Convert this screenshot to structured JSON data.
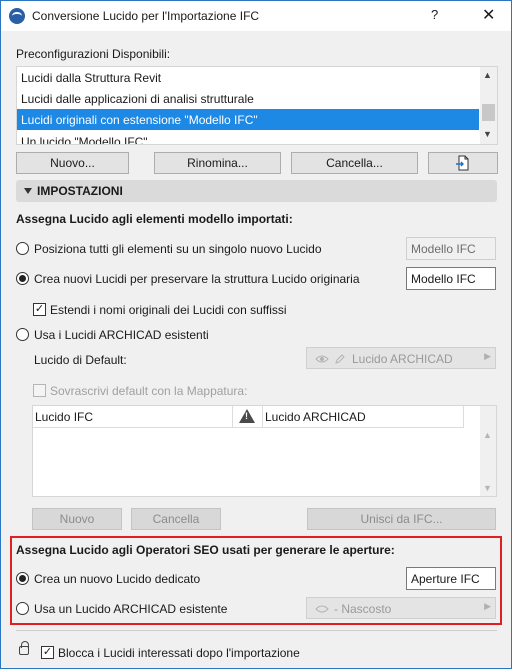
{
  "window": {
    "title": "Conversione Lucido per l'Importazione IFC",
    "help_label": "?",
    "close_label": "✕"
  },
  "presets": {
    "label": "Preconfigurazioni Disponibili:",
    "items": [
      "Lucidi dalla Struttura Revit",
      "Lucidi dalle applicazioni di analisi strutturale",
      "Lucidi originali con estensione \"Modello IFC\"",
      "Un lucido \"Modello IFC\""
    ],
    "selected_index": 2,
    "buttons": {
      "new": "Nuovo...",
      "rename": "Rinomina...",
      "delete": "Cancella..."
    },
    "export_icon": "export-file-icon"
  },
  "settings": {
    "header": "IMPOSTAZIONI",
    "assign_label": "Assegna Lucido agli elementi modello importati:",
    "opt_single": "Posiziona tutti gli elementi su un singolo nuovo Lucido",
    "opt_single_value": "Modello IFC",
    "opt_preserve": "Crea nuovi Lucidi per preservare la struttura Lucido originaria",
    "opt_preserve_value": "Modello IFC",
    "extend_names": "Estendi i nomi originali dei Lucidi con suffissi",
    "extend_names_checked": true,
    "opt_existing": "Usa i Lucidi ARCHICAD esistenti",
    "default_label": "Lucido di Default:",
    "default_value": "Lucido ARCHICAD",
    "overwrite_label": "Sovrascrivi default con la Mappatura:",
    "table": {
      "col_ifc": "Lucido IFC",
      "col_archicad": "Lucido ARCHICAD"
    },
    "buttons": {
      "new": "Nuovo",
      "delete": "Cancella",
      "merge": "Unisci da IFC..."
    },
    "selected_option": "preserve"
  },
  "openings": {
    "label": "Assegna Lucido agli Operatori SEO usati per generare le aperture:",
    "opt_new": "Crea un nuovo Lucido dedicato",
    "opt_new_value": "Aperture IFC",
    "opt_existing": "Usa un Lucido ARCHICAD esistente",
    "existing_value": "- Nascosto",
    "selected_option": "new"
  },
  "footer": {
    "lock_label": "Blocca i Lucidi interessati dopo l'importazione",
    "lock_checked": true
  },
  "colors": {
    "selection": "#1e88e5",
    "highlight_box": "#e02020",
    "window_border": "#2b76c2"
  }
}
